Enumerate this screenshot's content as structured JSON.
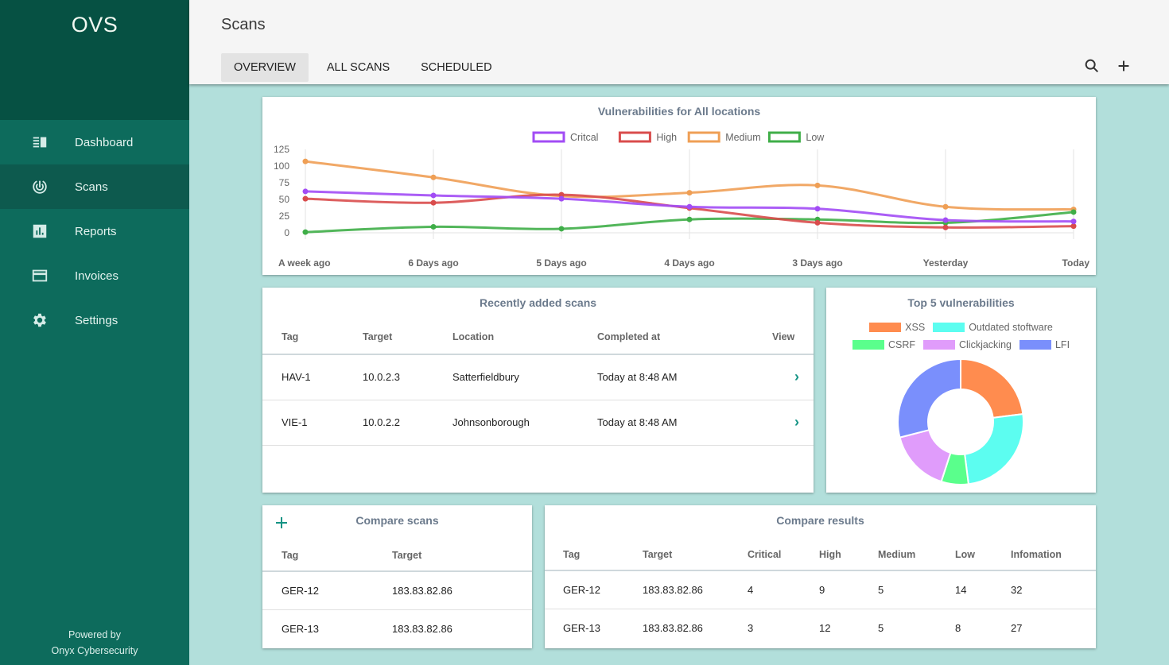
{
  "sidebar": {
    "brand": "OVS",
    "items": [
      {
        "label": "Dashboard",
        "icon": "dashboard-icon"
      },
      {
        "label": "Scans",
        "icon": "radar-icon",
        "active": true
      },
      {
        "label": "Reports",
        "icon": "bar-chart-icon"
      },
      {
        "label": "Invoices",
        "icon": "credit-card-icon"
      },
      {
        "label": "Settings",
        "icon": "gear-icon"
      }
    ],
    "footer_line1": "Powered by",
    "footer_line2": "Onyx Cybersecurity"
  },
  "header": {
    "title": "Scans",
    "tabs": [
      {
        "label": "OVERVIEW",
        "active": true
      },
      {
        "label": "ALL SCANS"
      },
      {
        "label": "SCHEDULED"
      }
    ],
    "actions": [
      "search-icon",
      "plus-icon"
    ]
  },
  "colors": {
    "critical": "#a24cf5",
    "high": "#d94c4c",
    "medium": "#ef9f55",
    "low": "#3fae48",
    "accent": "#139384"
  },
  "chart_data": [
    {
      "type": "line",
      "title": "Vulnerabilities for All locations",
      "categories": [
        "A week ago",
        "6 Days ago",
        "5 Days ago",
        "4 Days ago",
        "3 Days ago",
        "Yesterday",
        "Today"
      ],
      "series": [
        {
          "name": "Critcal",
          "color": "#a24cf5",
          "values": [
            62,
            56,
            51,
            39,
            36,
            19,
            17
          ]
        },
        {
          "name": "High",
          "color": "#d94c4c",
          "values": [
            51,
            45,
            57,
            37,
            15,
            8,
            10
          ]
        },
        {
          "name": "Medium",
          "color": "#ef9f55",
          "values": [
            107,
            83,
            55,
            60,
            71,
            39,
            35
          ]
        },
        {
          "name": "Low",
          "color": "#3fae48",
          "values": [
            1,
            9,
            6,
            20,
            20,
            15,
            31
          ]
        }
      ],
      "yticks": [
        0,
        25,
        50,
        75,
        100,
        125
      ],
      "ylim": [
        0,
        125
      ],
      "legend": "top-center",
      "grid": "vertical"
    },
    {
      "type": "pie",
      "title": "Top 5 vulnerabilities",
      "labels": [
        "XSS",
        "Outdated stoftware",
        "CSRF",
        "Clickjacking",
        "LFI"
      ],
      "values": [
        23,
        25,
        7,
        16,
        29
      ],
      "colors": [
        "#ff8c4f",
        "#5cfdf0",
        "#5aff8c",
        "#e09cfb",
        "#7a8ffc"
      ],
      "donut": true,
      "legend": "top-center"
    }
  ],
  "recent_scans": {
    "title": "Recently added scans",
    "columns": [
      "Tag",
      "Target",
      "Location",
      "Completed at",
      "View"
    ],
    "rows": [
      {
        "tag": "HAV-1",
        "target": "10.0.2.3",
        "location": "Satterfieldbury",
        "completed": "Today at 8:48 AM",
        "view": "›"
      },
      {
        "tag": "VIE-1",
        "target": "10.0.2.2",
        "location": "Johnsonborough",
        "completed": "Today at 8:48 AM",
        "view": "›"
      }
    ]
  },
  "compare_scans": {
    "title": "Compare scans",
    "columns": [
      "Tag",
      "Target"
    ],
    "rows": [
      {
        "tag": "GER-12",
        "target": "183.83.82.86"
      },
      {
        "tag": "GER-13",
        "target": "183.83.82.86"
      }
    ]
  },
  "compare_results": {
    "title": "Compare results",
    "columns": [
      "Tag",
      "Target",
      "Critical",
      "High",
      "Medium",
      "Low",
      "Infomation"
    ],
    "rows": [
      {
        "tag": "GER-12",
        "target": "183.83.82.86",
        "critical": "4",
        "high": "9",
        "medium": "5",
        "low": "14",
        "info": "32"
      },
      {
        "tag": "GER-13",
        "target": "183.83.82.86",
        "critical": "3",
        "high": "12",
        "medium": "5",
        "low": "8",
        "info": "27"
      }
    ]
  }
}
